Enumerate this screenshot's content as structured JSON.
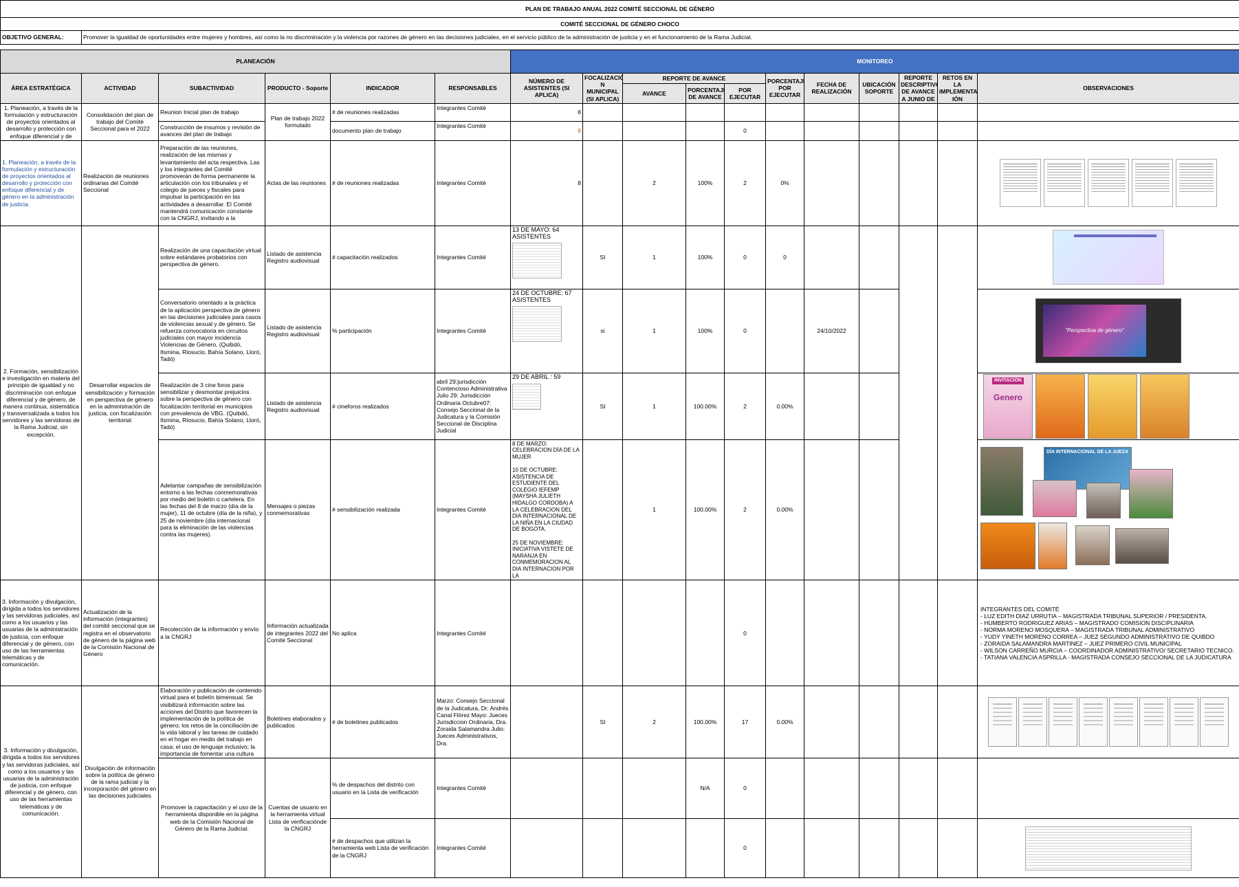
{
  "title": "PLAN DE TRABAJO ANUAL 2022 COMITÉ SECCIONAL DE GÉNERO",
  "subtitle": "COMITÉ SECCIONAL DE GÉNERO CHOCO",
  "objective": {
    "label": "OBJETIVO GENERAL:",
    "text": "Promover la igualdad de oportunidades entre mujeres y hombres, así como la no discriminación y la violencia por razones de género en las decisiones judiciales, en el servicio público de la administración de justicia y en el funcionamiento de la Rama Judicial."
  },
  "sections": {
    "planning": "PLANEACIÓN",
    "monitoring": "MONITOREO"
  },
  "headers": {
    "area": "ÁREA ESTRATÉGICA",
    "activity": "ACTIVIDAD",
    "subactivity": "SUBACTIVIDAD",
    "product": "PRODUCTO - Soporte",
    "indicator": "INDICADOR",
    "responsible": "RESPONSABLES",
    "attendees": "NÚMERO DE ASISTENTES (SI APLICA)",
    "focus": "FOCALIZACIÓ N MUNICIPAL (SI APLICA)",
    "report": "REPORTE DE AVANCE",
    "progress": "AVANCE",
    "pct_progress": "PORCENTAJE DE AVANCE",
    "to_execute": "POR EJECUTAR",
    "pct_to_execute": "PORCENTAJE POR EJECUTAR",
    "date": "FECHA DE REALIZACIÓN",
    "location": "UBICACIÓN SOPORTE",
    "desc_report": "REPORTE DESCRIPTIVO DE AVANCE A JUNIO DE",
    "challenges": "RETOS EN LA IMPLEMENTAC IÓN",
    "observations": "OBSERVACIONES"
  },
  "rows": {
    "r1": {
      "area": "1. Planeación, a través de la formulación y estructuración de proyectos orientados al desarrollo y protección con enfoque diferencial y de",
      "activity": "Consolidación del plan de trabajo del Comité Seccional para el 2022",
      "sub_a": "Reunion Inicial plan de trabajo",
      "sub_b": "Construcción de insumos y revisión de avances del plan de trabajo",
      "product": "Plan de trabajo 2022 formulado",
      "ind_a": "# de reuniones realizadas",
      "ind_b": "documento plan de trabajo",
      "resp_a": "Integrantes Comité",
      "resp_b": "Integrantes Comité",
      "att_a": "8",
      "att_b": "8",
      "toexec_b": "0"
    },
    "r2": {
      "area": "1. Planeación, a través de la formulación y estructuración de proyectos orientados al desarrollo y protección con enfoque diferencial y de género en la administración de justicia.",
      "activity": "Realización de reuniones ordinarias del Comité Seccional",
      "sub": "Preparación de las reuniones, realización de las mismas y levantamiento del acta respectiva. Las y los integrantes del Comité promoverán de forma permanente la articulación con los tribunales y el colegio de jueces y fiscales para impulsar la participación en las actividades a desarrollar. El Comité mantendrá comunicación constante con la CNGRJ, invitando a la",
      "product": "Actas de las reuniones",
      "ind": "# de reuniones realizadas",
      "resp": "Integrantes Comité",
      "att": "8",
      "progress": "2",
      "pct": "100%",
      "toexec": "2",
      "pct_toexec": "0%"
    },
    "area2": "2. Formación, sensibilización e investigación en materia del principio de igualdad y no discriminación con enfoque diferencial y de género, de manera continua, sistemática y transversalizada a todos los servidores y las servidoras de la Rama Judicial, sin excepción.",
    "activity2": "Desarrollar espacios de sensibilización y formación en perspectiva de género en la administración de justicia, con focalización territorial",
    "r3": {
      "sub": "Realización de una capacitación virtual sobre estándares probatorios con perspectiva de género.",
      "product": "Listado de asistencia Registro audiovisual",
      "ind": "# capacitación realizados",
      "resp": "Integrantes Comité",
      "att": "13 DE MAYO: 64 ASISTENTES",
      "focus": "SI",
      "progress": "1",
      "pct": "100%",
      "toexec": "0",
      "pct_toexec": "0"
    },
    "r4": {
      "sub": "Conversatorio orientado a la práctica de la aplicación perspectiva de género en las decisiones judiciales para casos de violencias sexual y de género. Se refuerza convocatoria en circuitos judiciales con mayor incidencia Violencias de Género. (Quibdó, Itsmina, Riosucio, Bahía Solano, Lloró, Tadó)",
      "product": "Listado de asistencia Registro audiovisual",
      "ind": "% participación",
      "resp": "Integrantes Comité",
      "att": "24 DE OCTUBRE: 67 ASISTENTES",
      "focus": "si",
      "progress": "1",
      "pct": "100%",
      "toexec": "0",
      "date": "24/10/2022",
      "slide_text": "\"Perspectiva de género\""
    },
    "r5": {
      "sub": "Realización de 3 cine foros para sensibilizar y desmontar prejuicios sobre la perspectiva de género con focalización territorial en municipios con prevalencia de VBG. (Quibdó, Itsmina, Riosucio, Bahía Solano, Lloró, Tadó)",
      "product": "Listado de asistencia Registro audiovisual",
      "ind": "# cineforos realizados",
      "resp": "abril 29:jurisdicción Contencioso Administrativa Julio 29: Jurisdicción Ordinaria Octubre07: Consejo Seccional de la Judicatura y la Comisión Seccional de Disciplina Judicial",
      "att": "29 DE ABRIL : 59",
      "focus": "SI",
      "progress": "1",
      "pct": "100.00%",
      "toexec": "2",
      "pct_toexec": "0.00%",
      "poster_text": "INVITACIÓN",
      "poster_word": "Genero"
    },
    "r6": {
      "sub": "Adelantar campañas de sensibilización entorno a las fechas conmemorativas por medio del boletín o cartelera. En las fechas del 8 de marzo (día de la mujer), 11 de octubre (día de la niña), y 25 de noviembre (día internacional para la eliminación de las violencias contra las mujeres).",
      "product": "Mensajes o piezas conmemorativas",
      "ind": "# sensibilización realizada",
      "resp": "Integrantes Comité",
      "att": "8 DE MARZO: CELEBRACION DÍA DE LA MUJER\n\n10 DE OCTUBRE: ASISTENCIA DE ESTUDIENTE DEL COLEGIO IEFEMP (MAYSHA JULIETH HIDALGO CORDOBA) A LA CELEBRACION DEL DIA INTERNACIONAL DE LA NIÑA EN LA CIUDAD DE BOGOTA.\n\n25 DE NOVIEMBRE: INICIATIVA VISTETE DE NARANJA EN CONMEMORACION AL DIA INTERNACION POR LA",
      "progress": "1",
      "pct": "100.00%",
      "toexec": "2",
      "pct_toexec": "0.00%",
      "poster_day": "DÍA INTERNACIONAL DE LA JUEZA"
    },
    "r7": {
      "area": "3. Información y divulgación, dirigida a todos los servidores y las servidoras judiciales, así como a los usuarios y las usuarias de la administración de justicia, con enfoque diferencial y de género, con uso de las herramientas telemáticas y de comunicación.",
      "activity": "Actualización de la información (integrantes) del comité seccional que se registra en el observatorio de género de la página web de la Comisión Nacional de Género",
      "sub": "Recolección de la información y envío a la CNGRJ",
      "product": "Información actualizada de integrantes 2022 del Comité Seccional",
      "ind": "No aplica",
      "resp": "Integrantes Comité",
      "toexec": "0",
      "obs": [
        "INTEGRANTES DEL COMITÉ",
        "- LUZ EDITH DIAZ URRUTIA – MAGISTRADA TRIBUNAL SUPERIOR / PRESIDENTA.",
        "- HUMBERTO RODRIGUEZ ARIAS – MAGISTRADO COMISION DISCIPLINARIA",
        "- NORMA MORENO MOSQUERA – MAGISTRADA TRIBUNAL ADMINISTRATIVO",
        "- YUDY YINETH MORENO CORREA – JUEZ SEGUNDO ADMINISTRATIVO DE QUIBDO",
        "- ZORAIDA SALAMANDRA MARTINEZ – JUEZ PRIMERO CIVIL MUNICIPAL",
        "- WILSON CARREÑO MURCIA – COORDINADOR ADMINISTRATIVO/ SECRETARIO TECNICO.",
        "- TATIANA VALENCIA ASPRILLA - MAGISTRADA CONSEJO SECCIONAL DE LA JUDICATURA"
      ]
    },
    "area3b": "3. Información y divulgación, dirigida a todos los servidores y las servidoras judiciales, así como a los usuarios y las usuarias de la administración de justicia, con enfoque diferencial y de género, con uso de las herramientas telemáticas y de comunicación.",
    "activity3b": "Divulgación de información sobre la política de género de la rama judicial y la incorporación del género en las decisiones judiciales",
    "r8": {
      "sub": "Elaboración y publicación de contenido virtual para el boletín bimensual. Se visibilizará información sobre las acciones del Distrito que favorecen la implementación de la política de género; los retos de la conciliación de la vida laboral y las tareas de cuidado en el hogar en medio del trabajo en casa; el uso de lenguaje inclusivo; la importancia de fomentar una cultura",
      "product": "Boletines elaborados y publicados",
      "ind": "# de boletines publicados",
      "resp": "Marzo: Consejo Seccional de la Judicatura, Dr. Andrés Canal Flórez Mayo: Jueces Jurisdiccion Ordinaria, Dra. Zoraida Salamandra Julio: Jueces Administrativos, Dra.",
      "focus": "SI",
      "progress": "2",
      "pct": "100.00%",
      "toexec": "17",
      "pct_toexec": "0.00%"
    },
    "r9": {
      "sub": "Promover la capacitación y el uso de la herramienta disponible en la página web de la Comisión Nacional de Género de la Rama Judicial.",
      "product": "Cuentas de usuario en la herramienta virtual Lista de verificaciónde la CNGRJ",
      "ind_a": "% de despachos del distrito con usuario en la Lista de verificación",
      "ind_b": "# de despachos que utilizan la herramienta web Lista de verificación de la CNGRJ",
      "resp_a": "Integrantes Comité",
      "resp_b": "Integrantes Comité",
      "pct_a": "N/A",
      "toexec_a": "0",
      "toexec_b": "0"
    }
  }
}
